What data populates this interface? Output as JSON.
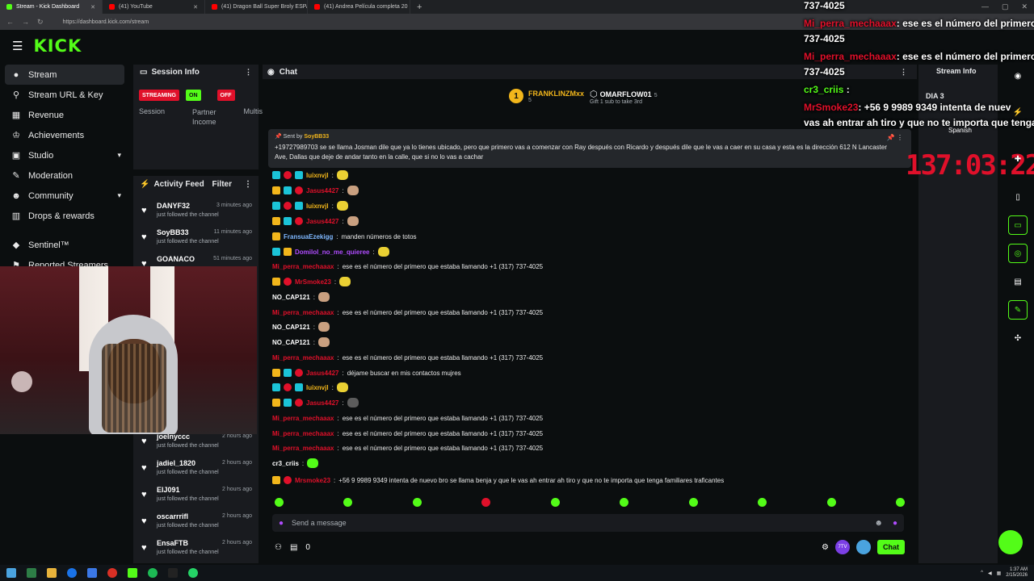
{
  "browser": {
    "tabs": [
      {
        "label": "Stream - Kick Dashboard",
        "color": "#53fc18"
      },
      {
        "label": "(41) YouTube",
        "color": "#ff0000"
      },
      {
        "label": "(41) Dragon Ball Super Broly ESPA",
        "color": "#ff0000"
      },
      {
        "label": "(41) Andrea Película completa 20",
        "color": "#ff0000"
      }
    ],
    "url": "https://dashboard.kick.com/stream"
  },
  "app": {
    "logo": "KICK"
  },
  "sidebar": {
    "items": [
      {
        "label": "Stream",
        "icon": "stream-icon",
        "glyph": "●"
      },
      {
        "label": "Stream URL & Key",
        "icon": "link-icon",
        "glyph": "⚲"
      },
      {
        "label": "Revenue",
        "icon": "revenue-icon",
        "glyph": "▦"
      },
      {
        "label": "Achievements",
        "icon": "trophy-icon",
        "glyph": "♔"
      },
      {
        "label": "Studio",
        "icon": "studio-icon",
        "glyph": "▣"
      },
      {
        "label": "Moderation",
        "icon": "wrench-icon",
        "glyph": "✎"
      },
      {
        "label": "Community",
        "icon": "community-icon",
        "glyph": "☻"
      },
      {
        "label": "Drops & rewards",
        "icon": "drops-icon",
        "glyph": "▥"
      },
      {
        "label": "Sentinel™",
        "icon": "shield-icon",
        "glyph": "◆"
      },
      {
        "label": "Reported Streamers",
        "icon": "flag-icon",
        "glyph": "⚑"
      }
    ]
  },
  "session": {
    "title": "Session Info",
    "badges": {
      "streaming": "STREAMING",
      "on": "ON",
      "off": "OFF"
    },
    "labels": [
      "Session",
      "Partner Income",
      "Multis"
    ]
  },
  "activity": {
    "title": "Activity Feed",
    "filter": "Filter",
    "items": [
      {
        "name": "DANYF32",
        "time": "3 minutes ago",
        "desc": "just followed the channel"
      },
      {
        "name": "SoyBB33",
        "time": "11 minutes ago",
        "desc": "just followed the channel"
      },
      {
        "name": "GOANACO",
        "time": "51 minutes ago",
        "desc": ""
      },
      {
        "name": "joelnyccc",
        "time": "2 hours ago",
        "desc": "just followed the channel"
      },
      {
        "name": "jadiel_1820",
        "time": "2 hours ago",
        "desc": "just followed the channel"
      },
      {
        "name": "ElJ091",
        "time": "2 hours ago",
        "desc": "just followed the channel"
      },
      {
        "name": "oscarrrifl",
        "time": "2 hours ago",
        "desc": "just followed the channel"
      },
      {
        "name": "EnsaFTB",
        "time": "2 hours ago",
        "desc": "just followed the channel"
      }
    ]
  },
  "chat": {
    "title": "Chat",
    "leader1": {
      "rank": "1",
      "name": "FRANKLINZMxx",
      "count": "5"
    },
    "leader2": {
      "name": "OMARFLOW01",
      "count": "5",
      "sub": "Gift 1 sub to take 3rd"
    },
    "pinned": {
      "by_label": "Sent by",
      "by": "SoyBB33",
      "text": "+19727989703 se se llama Josman dile que ya lo tienes ubicado, pero que primero vas a comenzar con Ray después con Ricardo y después dile que le vas a caer en su casa y esta es la dirección 612 N Lancaster Ave, Dallas que deje de andar tanto en la calle, que si no lo vas a cachar"
    },
    "messages": [
      {
        "user": "luixnvjl",
        "color": "#f2b61b",
        "text": "",
        "badges": [
          "t",
          "r",
          "t"
        ],
        "emote": "yel"
      },
      {
        "user": "Jasus4427",
        "color": "#e0102a",
        "text": "",
        "badges": [
          "y",
          "t",
          "r"
        ],
        "emote": "cat"
      },
      {
        "user": "luixnvjl",
        "color": "#f2b61b",
        "text": "",
        "badges": [
          "t",
          "r",
          "t"
        ],
        "emote": "yel"
      },
      {
        "user": "Jasus4427",
        "color": "#e0102a",
        "text": "",
        "badges": [
          "y",
          "t",
          "r"
        ],
        "emote": "cat"
      },
      {
        "user": "FransuaEzekigg",
        "color": "#7fb8ff",
        "text": "manden números de totos",
        "badges": [
          "y"
        ],
        "emote": ""
      },
      {
        "user": "Domilol_no_me_quieree",
        "color": "#b04cff",
        "text": "",
        "badges": [
          "t",
          "y"
        ],
        "emote": "yel"
      },
      {
        "user": "Mi_perra_mechaaax",
        "color": "#e0102a",
        "text": "ese es el número del primero que estaba llamando +1 (317) 737-4025",
        "badges": [],
        "emote": ""
      },
      {
        "user": "MrSmoke23",
        "color": "#e0102a",
        "text": "",
        "badges": [
          "y",
          "r"
        ],
        "emote": "yel"
      },
      {
        "user": "NO_CAP121",
        "color": "#ffffff",
        "text": "",
        "badges": [],
        "emote": "cat"
      },
      {
        "user": "Mi_perra_mechaaax",
        "color": "#e0102a",
        "text": "ese es el número del primero que estaba llamando +1 (317) 737-4025",
        "badges": [],
        "emote": ""
      },
      {
        "user": "NO_CAP121",
        "color": "#ffffff",
        "text": "",
        "badges": [],
        "emote": "cat"
      },
      {
        "user": "NO_CAP121",
        "color": "#ffffff",
        "text": "",
        "badges": [],
        "emote": "cat"
      },
      {
        "user": "Mi_perra_mechaaax",
        "color": "#e0102a",
        "text": "ese es el número del primero que estaba llamando +1 (317) 737-4025",
        "badges": [],
        "emote": ""
      },
      {
        "user": "Jasus4427",
        "color": "#e0102a",
        "text": "déjame buscar en mis contactos mujres",
        "badges": [
          "y",
          "t",
          "r"
        ],
        "emote": ""
      },
      {
        "user": "luixnvjl",
        "color": "#f2b61b",
        "text": "",
        "badges": [
          "t",
          "r",
          "t"
        ],
        "emote": "yel"
      },
      {
        "user": "Jasus4427",
        "color": "#e0102a",
        "text": "",
        "badges": [
          "y",
          "t",
          "r"
        ],
        "emote": "man"
      },
      {
        "user": "Mi_perra_mechaaax",
        "color": "#e0102a",
        "text": "ese es el número del primero que estaba llamando +1 (317) 737-4025",
        "badges": [],
        "emote": ""
      },
      {
        "user": "Mi_perra_mechaaax",
        "color": "#e0102a",
        "text": "ese es el número del primero que estaba llamando +1 (317) 737-4025",
        "badges": [],
        "emote": ""
      },
      {
        "user": "Mi_perra_mechaaax",
        "color": "#e0102a",
        "text": "ese es el número del primero que estaba llamando +1 (317) 737-4025",
        "badges": [],
        "emote": ""
      },
      {
        "user": "cr3_criis",
        "color": "#ffffff",
        "text": "",
        "badges": [],
        "emote": "gr"
      },
      {
        "user": "Mrsmoke23",
        "color": "#e0102a",
        "text": "+56 9 9989 9349 intenta de nuevo bro se llama benja y que le vas ah entrar ah tiro y que no te importa que tenga familiares traficantes",
        "badges": [
          "y",
          "r"
        ],
        "emote": ""
      }
    ],
    "send_placeholder": "Send a message",
    "bottom_count": "0",
    "chat_button": "Chat",
    "badge_7tv": "7TV"
  },
  "right": {
    "title": "Stream Info",
    "dia": "DIA 3",
    "lang": "Spanish",
    "timer": "137:03:22"
  },
  "overlay": {
    "lines": [
      {
        "user": "",
        "text": "737-4025"
      },
      {
        "user": "Mi_perra_mechaaax",
        "text": ": ese es el número del primero"
      },
      {
        "user": "",
        "text": "737-4025"
      },
      {
        "user": "Mi_perra_mechaaax",
        "text": ": ese es el número del primero"
      },
      {
        "user": "",
        "text": "737-4025"
      },
      {
        "user": "cr3_criis",
        "text": " :"
      },
      {
        "user": "MrSmoke23",
        "text": ": +56 9 9989 9349 intenta de nuev"
      },
      {
        "user": "",
        "text": "vas ah entrar ah tiro y que no te importa que tenga fa"
      }
    ]
  },
  "taskbar": {
    "time": "1:37 AM",
    "date": "2/15/2026"
  }
}
